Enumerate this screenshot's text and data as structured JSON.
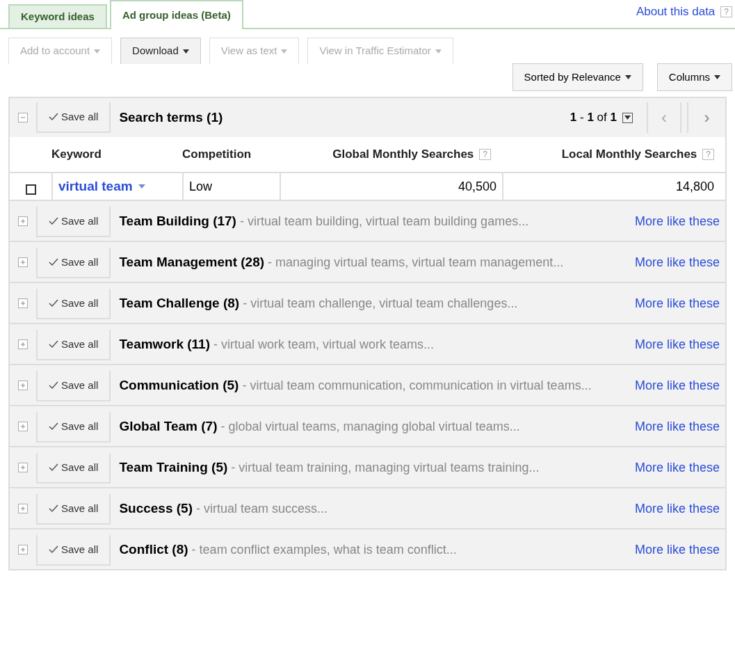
{
  "tabs": [
    {
      "label": "Keyword ideas",
      "selected": false
    },
    {
      "label": "Ad group ideas (Beta)",
      "selected": true
    }
  ],
  "about_link": "About this data",
  "help_mark": "?",
  "toolbar": [
    {
      "label": "Add to account",
      "disabled": true
    },
    {
      "label": "Download",
      "disabled": false
    },
    {
      "label": "View as text",
      "disabled": true
    },
    {
      "label": "View in Traffic Estimator",
      "disabled": true
    }
  ],
  "sort_button": "Sorted by Relevance",
  "columns_button": "Columns",
  "search_terms": {
    "title": "Search terms (1)",
    "expanded": true,
    "save_label": "Save all",
    "pager_from": "1",
    "pager_sep": " - ",
    "pager_to": "1",
    "pager_of": "of",
    "pager_total": "1",
    "prev": "‹",
    "next": "›",
    "columns": [
      {
        "label": "Keyword"
      },
      {
        "label": "Competition"
      },
      {
        "label": "Global Monthly Searches",
        "help": "?"
      },
      {
        "label": "Local Monthly Searches",
        "help": "?"
      }
    ],
    "rows": [
      {
        "checked": false,
        "keyword": "virtual team",
        "competition": "Low",
        "global": "40,500",
        "local": "14,800"
      }
    ]
  },
  "groups": [
    {
      "title": "Team Building (17)",
      "keywords": "- virtual team building, virtual team building games...",
      "expanded": false,
      "save_label": "Save all",
      "link": "More like these"
    },
    {
      "title": "Team Management (28)",
      "keywords": "- managing virtual teams, virtual team management...",
      "expanded": false,
      "save_label": "Save all",
      "link": "More like these"
    },
    {
      "title": "Team Challenge (8)",
      "keywords": "- virtual team challenge, virtual team challenges...",
      "expanded": false,
      "save_label": "Save all",
      "link": "More like these"
    },
    {
      "title": "Teamwork (11)",
      "keywords": "- virtual work team, virtual work teams...",
      "expanded": false,
      "save_label": "Save all",
      "link": "More like these"
    },
    {
      "title": "Communication (5)",
      "keywords": "- virtual team communication, communication in virtual teams...",
      "expanded": false,
      "save_label": "Save all",
      "link": "More like these"
    },
    {
      "title": "Global Team (7)",
      "keywords": "- global virtual teams, managing global virtual teams...",
      "expanded": false,
      "save_label": "Save all",
      "link": "More like these"
    },
    {
      "title": "Team Training (5)",
      "keywords": "- virtual team training, managing virtual teams training...",
      "expanded": false,
      "save_label": "Save all",
      "link": "More like these"
    },
    {
      "title": "Success (5)",
      "keywords": "- virtual team success...",
      "expanded": false,
      "save_label": "Save all",
      "link": "More like these"
    },
    {
      "title": "Conflict (8)",
      "keywords": "- team conflict examples, what is team conflict...",
      "expanded": false,
      "save_label": "Save all",
      "link": "More like these"
    }
  ]
}
